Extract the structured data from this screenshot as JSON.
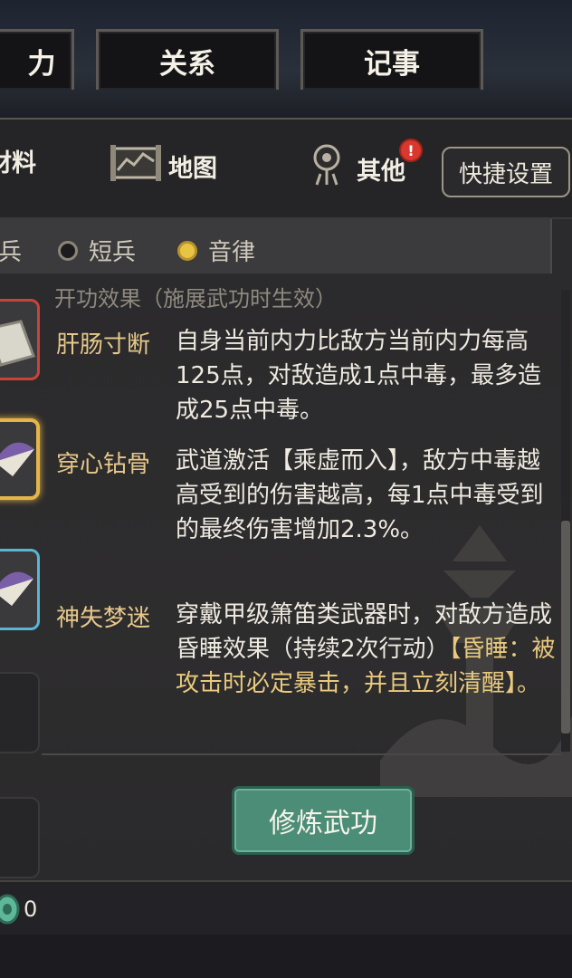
{
  "tabs": [
    {
      "label": "力"
    },
    {
      "label": "关系"
    },
    {
      "label": "记事"
    }
  ],
  "header": {
    "materials_label": "材料",
    "map_label": "地图",
    "other_label": "其他",
    "other_badge": "!",
    "quick_settings_label": "快捷设置"
  },
  "filters": [
    {
      "label": "兵"
    },
    {
      "label": "短兵"
    },
    {
      "label": "音律"
    }
  ],
  "panel": {
    "section_title": "开功效果（施展武功时生效）",
    "effects": [
      {
        "name": "肝肠寸断",
        "desc": "自身当前内力比敌方当前内力每高125点，对敌造成1点中毒，最多造成25点中毒。"
      },
      {
        "name": "穿心钻骨",
        "desc": "武道激活【乘虚而入】，敌方中毒越高受到的伤害越高，每1点中毒受到的最终伤害增加2.3%。"
      },
      {
        "name": "神失梦迷",
        "desc": "穿戴甲级箫笛类武器时，对敌方造成昏睡效果（持续2次行动）",
        "desc_highlight": "【昏睡：被攻击时必定暴击，并且立刻清醒】。"
      }
    ]
  },
  "train_button_label": "修炼武功",
  "bottom": {
    "count": "0"
  },
  "colors": {
    "accent_green": "#4c8d78",
    "effect_name": "#e7c88a",
    "highlight": "#e8c97e",
    "badge_red": "#d8382d"
  }
}
